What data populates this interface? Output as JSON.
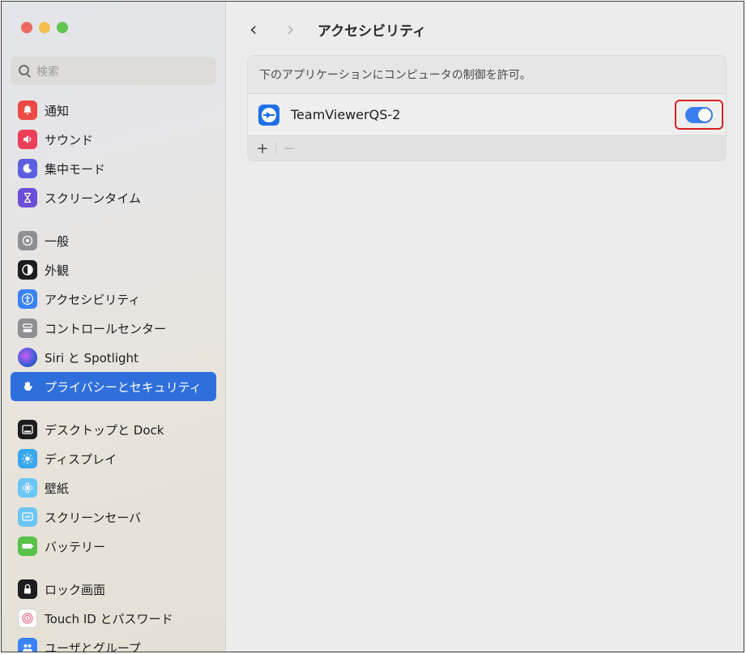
{
  "sidebar": {
    "search_placeholder": "検索",
    "groups": [
      [
        {
          "label": "通知",
          "icon": "bell-icon"
        },
        {
          "label": "サウンド",
          "icon": "speaker-icon"
        },
        {
          "label": "集中モード",
          "icon": "moon-icon"
        },
        {
          "label": "スクリーンタイム",
          "icon": "hourglass-icon"
        }
      ],
      [
        {
          "label": "一般",
          "icon": "gear-icon"
        },
        {
          "label": "外観",
          "icon": "appearance-icon"
        },
        {
          "label": "アクセシビリティ",
          "icon": "accessibility-icon"
        },
        {
          "label": "コントロールセンター",
          "icon": "control-center-icon"
        },
        {
          "label": "Siri と Spotlight",
          "icon": "siri-icon"
        },
        {
          "label": "プライバシーとセキュリティ",
          "icon": "hand-icon",
          "active": true
        }
      ],
      [
        {
          "label": "デスクトップと Dock",
          "icon": "dock-icon"
        },
        {
          "label": "ディスプレイ",
          "icon": "sun-icon"
        },
        {
          "label": "壁紙",
          "icon": "flower-icon"
        },
        {
          "label": "スクリーンセーバ",
          "icon": "screensaver-icon"
        },
        {
          "label": "バッテリー",
          "icon": "battery-icon"
        }
      ],
      [
        {
          "label": "ロック画面",
          "icon": "lock-icon"
        },
        {
          "label": "Touch ID とパスワード",
          "icon": "fingerprint-icon"
        },
        {
          "label": "ユーザとグループ",
          "icon": "users-icon"
        }
      ]
    ]
  },
  "main": {
    "back": "‹",
    "forward": "›",
    "title": "アクセシビリティ",
    "panel": {
      "header": "下のアプリケーションにコンピュータの制御を許可。",
      "apps": [
        {
          "name": "TeamViewerQS-2",
          "icon": "teamviewer-icon",
          "enabled": true
        }
      ],
      "add_label": "+",
      "remove_label": "−"
    }
  },
  "colors": {
    "accent": "#2f6fdc",
    "toggle_on": "#3a7ff0",
    "highlight_border": "#d81f1f"
  }
}
